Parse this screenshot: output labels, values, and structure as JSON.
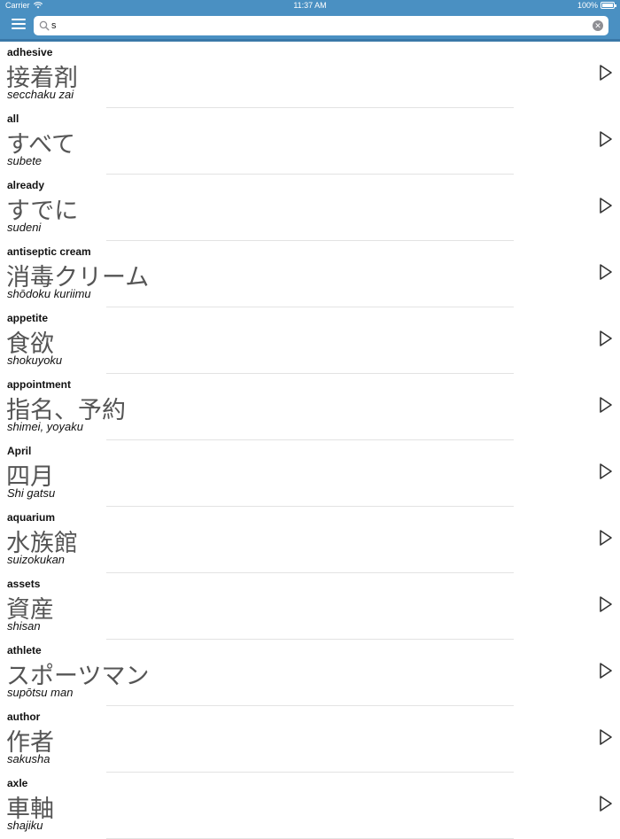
{
  "status": {
    "carrier": "Carrier",
    "time": "11:37 AM",
    "battery": "100%",
    "battery_level": 1.0
  },
  "search": {
    "value": "s",
    "placeholder": ""
  },
  "colors": {
    "accent": "#4a90c2"
  },
  "words": [
    {
      "en": "adhesive",
      "jp": "接着剤",
      "romaji": "secchaku zai"
    },
    {
      "en": "all",
      "jp": "すべて",
      "romaji": "subete"
    },
    {
      "en": "already",
      "jp": "すでに",
      "romaji": "sudeni"
    },
    {
      "en": "antiseptic cream",
      "jp": "消毒クリーム",
      "romaji": "shōdoku kuriimu"
    },
    {
      "en": "appetite",
      "jp": "食欲",
      "romaji": "shokuyoku"
    },
    {
      "en": "appointment",
      "jp": "指名、予約",
      "romaji": "shimei, yoyaku"
    },
    {
      "en": "April",
      "jp": "四月",
      "romaji": "Shi gatsu"
    },
    {
      "en": "aquarium",
      "jp": "水族館",
      "romaji": "suizokukan"
    },
    {
      "en": "assets",
      "jp": "資産",
      "romaji": "shisan"
    },
    {
      "en": "athlete",
      "jp": "スポーツマン",
      "romaji": "supōtsu man"
    },
    {
      "en": "author",
      "jp": "作者",
      "romaji": "sakusha"
    },
    {
      "en": "axle",
      "jp": "車軸",
      "romaji": "shajiku"
    }
  ]
}
